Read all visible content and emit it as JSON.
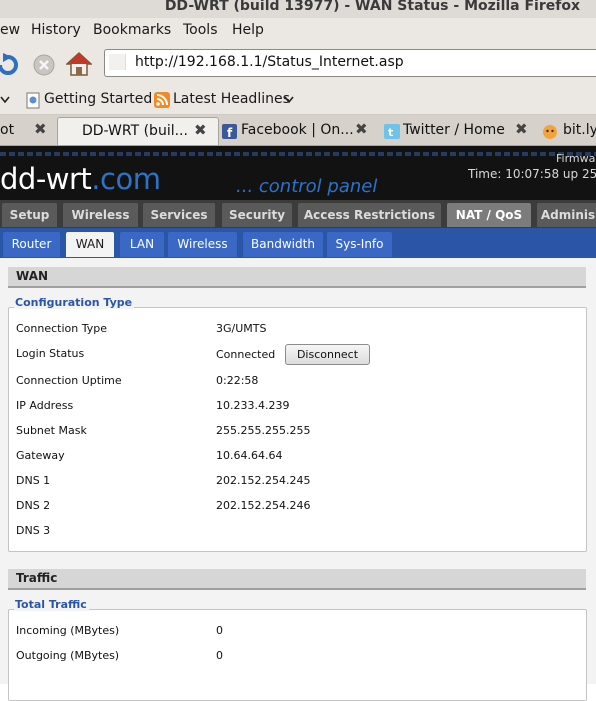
{
  "window": {
    "title": "DD-WRT (build 13977) - WAN Status - Mozilla Firefox"
  },
  "menu": [
    "ew",
    "History",
    "Bookmarks",
    "Tools",
    "Help"
  ],
  "address": {
    "url": "http://192.168.1.1/Status_Internet.asp"
  },
  "bookmarks": [
    "Getting Started",
    "Latest Headlines"
  ],
  "tabs": [
    {
      "label": "ot"
    },
    {
      "label": "DD-WRT (buil..."
    },
    {
      "label": "Facebook | On..."
    },
    {
      "label": "Twitter / Home"
    },
    {
      "label": "bit.ly"
    }
  ],
  "router": {
    "logo_main": "dd-wrt",
    "logo_suffix": ".com",
    "tagline": "... control panel",
    "firmware_label": "Firmwa",
    "time_text": "Time: 10:07:58 up 25 m"
  },
  "main_tabs": [
    "Setup",
    "Wireless",
    "Services",
    "Security",
    "Access Restrictions",
    "NAT / QoS",
    "Adminis"
  ],
  "main_tab_active": "NAT / QoS",
  "sub_tabs": [
    "Router",
    "WAN",
    "LAN",
    "Wireless",
    "Bandwidth",
    "Sys-Info"
  ],
  "sub_tab_active": "WAN",
  "wan": {
    "heading": "WAN",
    "legend": "Configuration Type",
    "connection_type": {
      "label": "Connection Type",
      "value": "3G/UMTS"
    },
    "login_status": {
      "label": "Login Status",
      "value": "Connected",
      "button": "Disconnect"
    },
    "uptime": {
      "label": "Connection Uptime",
      "value": "0:22:58"
    },
    "ip": {
      "label": "IP Address",
      "value": "10.233.4.239"
    },
    "mask": {
      "label": "Subnet Mask",
      "value": "255.255.255.255"
    },
    "gateway": {
      "label": "Gateway",
      "value": "10.64.64.64"
    },
    "dns1": {
      "label": "DNS 1",
      "value": "202.152.254.245"
    },
    "dns2": {
      "label": "DNS 2",
      "value": "202.152.254.246"
    },
    "dns3": {
      "label": "DNS 3",
      "value": ""
    }
  },
  "traffic": {
    "heading": "Traffic",
    "legend": "Total Traffic",
    "incoming": {
      "label": "Incoming (MBytes)",
      "value": "0"
    },
    "outgoing": {
      "label": "Outgoing (MBytes)",
      "value": "0"
    }
  },
  "colors": {
    "ddwrt_blue": "#2b56a8",
    "header_black": "#121212"
  }
}
